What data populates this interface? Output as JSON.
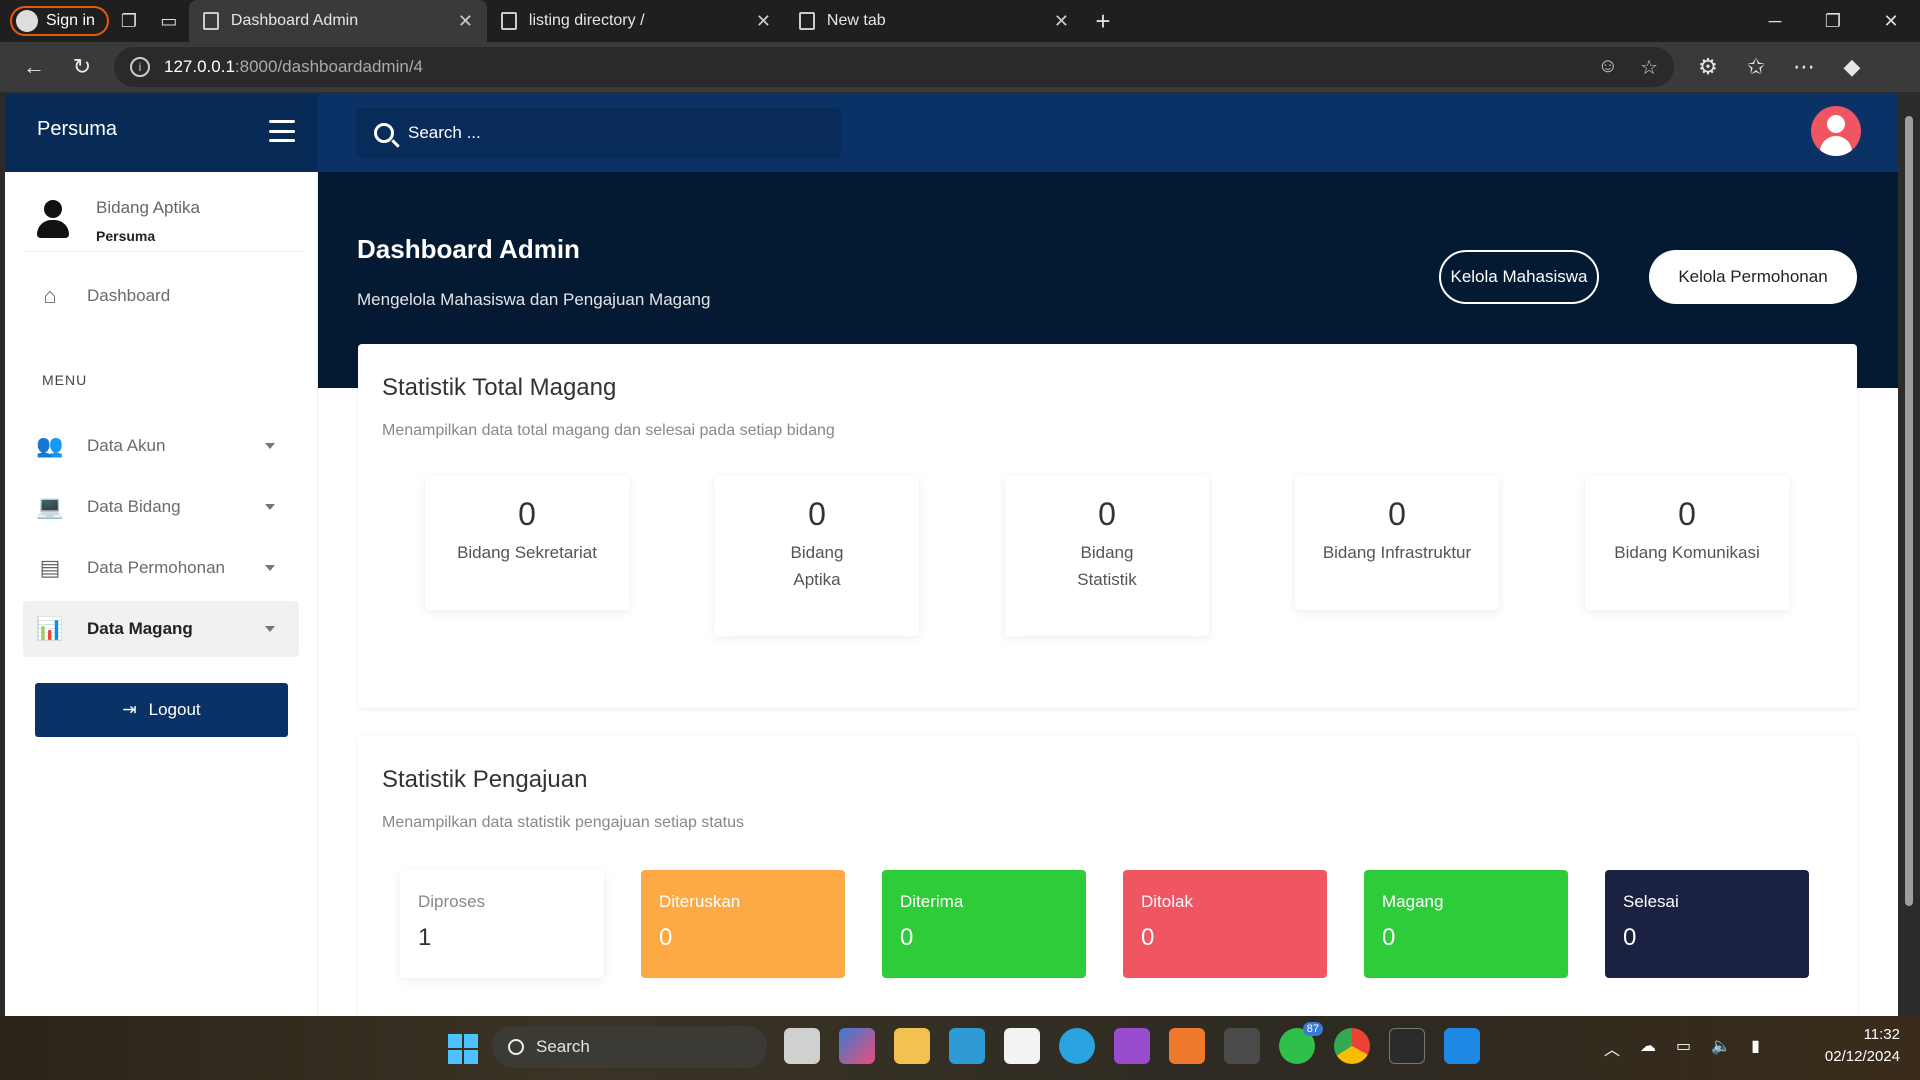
{
  "browser": {
    "signin_label": "Sign in",
    "tabs": [
      {
        "title": "Dashboard Admin",
        "active": true
      },
      {
        "title": "listing directory /",
        "active": false
      },
      {
        "title": "New tab",
        "active": false
      }
    ],
    "url_host": "127.0.0.1",
    "url_rest": ":8000/dashboardadmin/4"
  },
  "app": {
    "brand": "Persuma",
    "search_placeholder": "Search ..."
  },
  "sidebar": {
    "profile_name": "Bidang Aptika",
    "profile_role": "Persuma",
    "dashboard_label": "Dashboard",
    "menu_label": "MENU",
    "items": [
      {
        "label": "Data Akun",
        "icon": "users-icon"
      },
      {
        "label": "Data Bidang",
        "icon": "laptop-icon"
      },
      {
        "label": "Data Permohonan",
        "icon": "document-icon"
      },
      {
        "label": "Data Magang",
        "icon": "bar-chart-icon",
        "active": true
      }
    ],
    "logout_label": "Logout"
  },
  "header": {
    "title": "Dashboard Admin",
    "subtitle": "Mengelola Mahasiswa dan Pengajuan Magang",
    "btn_mahasiswa": "Kelola Mahasiswa",
    "btn_permohonan": "Kelola Permohonan"
  },
  "total_magang": {
    "title": "Statistik Total Magang",
    "subtitle": "Menampilkan data total magang dan selesai pada setiap bidang",
    "stats": [
      {
        "value": "0",
        "label": "Bidang Sekretariat"
      },
      {
        "value": "0",
        "label": "Bidang Aptika"
      },
      {
        "value": "0",
        "label": "Bidang Statistik"
      },
      {
        "value": "0",
        "label": "Bidang Infrastruktur"
      },
      {
        "value": "0",
        "label": "Bidang Komunikasi"
      }
    ]
  },
  "pengajuan": {
    "title": "Statistik Pengajuan",
    "subtitle": "Menampilkan data statistik pengajuan setiap status",
    "statuses": [
      {
        "label": "Diproses",
        "value": "1",
        "color": "#ffffff"
      },
      {
        "label": "Diteruskan",
        "value": "0",
        "color": "#fda945"
      },
      {
        "label": "Diterima",
        "value": "0",
        "color": "#2ecc38"
      },
      {
        "label": "Ditolak",
        "value": "0",
        "color": "#ef5662"
      },
      {
        "label": "Magang",
        "value": "0",
        "color": "#2ecc38"
      },
      {
        "label": "Selesai",
        "value": "0",
        "color": "#1b2140"
      }
    ]
  },
  "taskbar": {
    "search_label": "Search",
    "time": "11:32",
    "date": "02/12/2024",
    "badge": "87"
  }
}
